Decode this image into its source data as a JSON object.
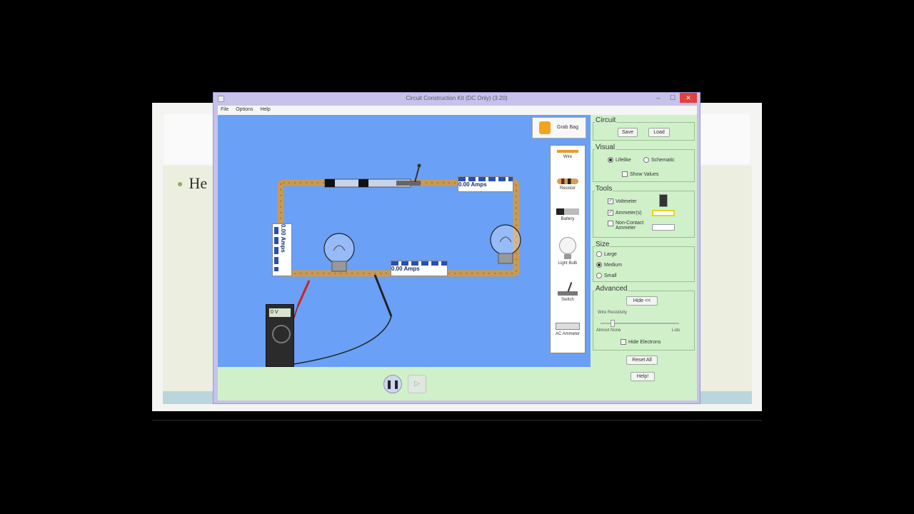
{
  "slide": {
    "bullet_text": "He"
  },
  "window": {
    "title": "Circuit Construction Kit (DC Only) (3.20)",
    "min_glyph": "–",
    "max_glyph": "☐",
    "close_glyph": "✕"
  },
  "menu": {
    "items": [
      "File",
      "Options",
      "Help"
    ]
  },
  "canvas": {
    "grab_bag_label": "Grab Bag",
    "ammeter_readings": [
      "0.00 Amps",
      "0.00 Amps",
      "0.00 Amps"
    ],
    "voltmeter_reading": "0 V"
  },
  "toolbox": {
    "items": [
      "Wire",
      "Resistor",
      "Battery",
      "Light Bulb",
      "Switch",
      "AC Ammeter"
    ]
  },
  "playback": {
    "pause_glyph": "❚❚",
    "step_glyph": "▷"
  },
  "side_panel": {
    "circuit": {
      "title": "Circuit",
      "save": "Save",
      "load": "Load"
    },
    "visual": {
      "title": "Visual",
      "lifelike": "Lifelike",
      "schematic": "Schematic",
      "show_values": "Show Values",
      "selected": "Lifelike"
    },
    "tools": {
      "title": "Tools",
      "voltmeter": "Voltmeter",
      "ammeter": "Ammeter(s)",
      "non_contact_ammeter": "Non-Contact Ammeter"
    },
    "size": {
      "title": "Size",
      "large": "Large",
      "medium": "Medium",
      "small": "Small",
      "selected": "Medium"
    },
    "advanced": {
      "title": "Advanced",
      "hide": "Hide <<",
      "wire_resistivity": "Wire Resistivity",
      "slider_min": "Almost None",
      "slider_max": "Lots",
      "hide_electrons": "Hide Electrons"
    },
    "reset_all": "Reset All",
    "help": "Help!"
  },
  "colors": {
    "canvas_bg": "#6aa0f5",
    "panel_bg": "#cff0c9",
    "window_frame": "#c7c2ea",
    "close_btn": "#e04040"
  }
}
